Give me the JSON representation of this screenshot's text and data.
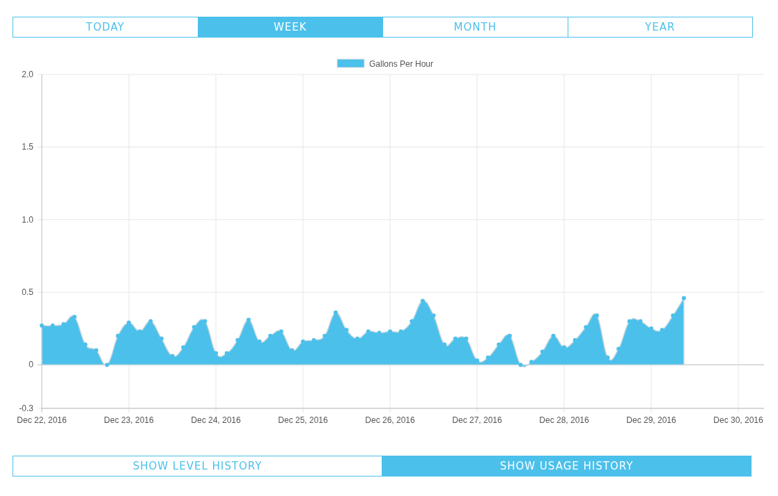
{
  "tabs": [
    {
      "label": "TODAY",
      "selected": false
    },
    {
      "label": "WEEK",
      "selected": true
    },
    {
      "label": "MONTH",
      "selected": false
    },
    {
      "label": "YEAR",
      "selected": false
    }
  ],
  "chart": {
    "chart_data": {
      "type": "area",
      "categories": [
        "Dec 22, 2016",
        null,
        null,
        null,
        null,
        null,
        null,
        null,
        "Dec 23, 2016",
        null,
        null,
        null,
        null,
        null,
        null,
        null,
        "Dec 24, 2016",
        null,
        null,
        null,
        null,
        null,
        null,
        null,
        "Dec 25, 2016",
        null,
        null,
        null,
        null,
        null,
        null,
        null,
        "Dec 26, 2016",
        null,
        null,
        null,
        null,
        null,
        null,
        null,
        "Dec 27, 2016",
        null,
        null,
        null,
        null,
        null,
        null,
        null,
        "Dec 28, 2016",
        null,
        null,
        null,
        null,
        null,
        null,
        null,
        "Dec 29, 2016",
        null,
        null,
        null,
        null,
        null,
        null,
        null,
        "Dec 30, 2016"
      ],
      "series": [
        {
          "name": "Gallons Per Hour",
          "color": "#4bc0eb",
          "values": [
            0.27,
            0.27,
            0.28,
            0.33,
            0.14,
            0.1,
            0.0,
            0.2,
            0.29,
            0.23,
            0.3,
            0.18,
            0.06,
            0.12,
            0.26,
            0.3,
            0.08,
            0.08,
            0.17,
            0.31,
            0.16,
            0.2,
            0.23,
            0.1,
            0.16,
            0.17,
            0.2,
            0.36,
            0.24,
            0.18,
            0.23,
            0.22,
            0.23,
            0.23,
            0.3,
            0.44,
            0.34,
            0.14,
            0.18,
            0.18,
            0.03,
            0.05,
            0.14,
            0.2,
            0.0,
            0.02,
            0.09,
            0.2,
            0.12,
            0.17,
            0.26,
            0.34,
            0.05,
            0.11,
            0.3,
            0.3,
            0.25,
            0.24,
            0.34,
            0.46,
            null,
            null,
            null,
            null,
            null
          ]
        }
      ],
      "ylim": [
        -0.3,
        2.0
      ],
      "grid": true,
      "yticks": [
        {
          "value": 2.0,
          "label": "2.0"
        },
        {
          "value": 1.5,
          "label": "1.5"
        },
        {
          "value": 1.0,
          "label": "1.0"
        },
        {
          "value": 0.5,
          "label": "0.5"
        },
        {
          "value": 0,
          "label": "0"
        },
        {
          "value": -0.3,
          "label": "-0.3"
        }
      ]
    }
  },
  "history_buttons": [
    {
      "label": "SHOW LEVEL HISTORY",
      "selected": false
    },
    {
      "label": "SHOW USAGE HISTORY",
      "selected": true
    }
  ]
}
